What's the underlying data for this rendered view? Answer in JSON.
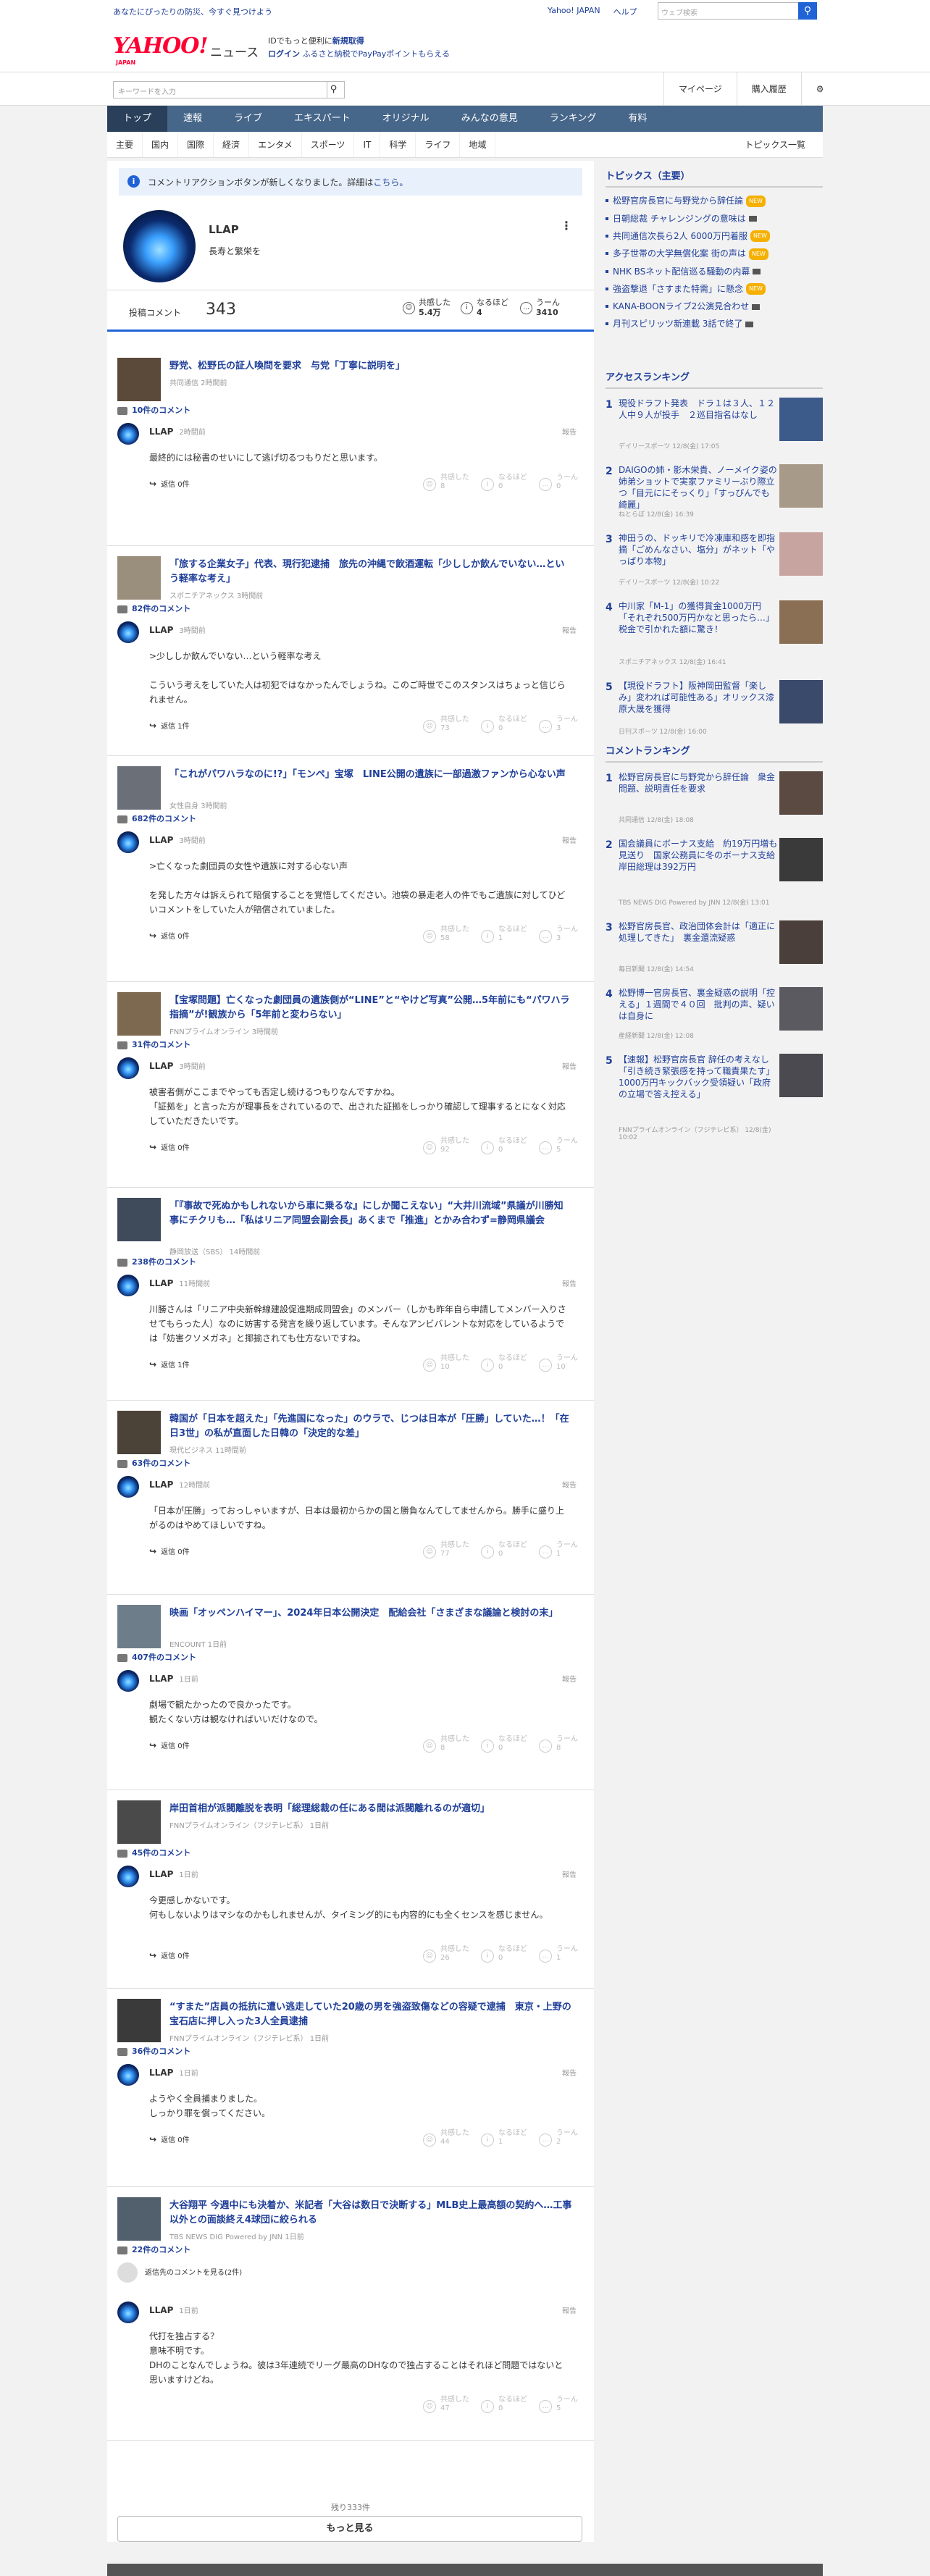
{
  "top": {
    "promo": "あなたにぴったりの防災、今すぐ見つけよう",
    "links": [
      "Yahoo! JAPAN",
      "ヘルプ"
    ],
    "search_placeholder": "ウェブ検索"
  },
  "header": {
    "logo": "YAHOO!",
    "logo_sub": "JAPAN",
    "service": "ニュース",
    "id_line1": "IDでもっと便利に",
    "id_new": "新規取得",
    "login": "ログイン",
    "id_line2": "ふるさと納税でPayPayポイントもらえる"
  },
  "search": {
    "placeholder": "キーワードを入力",
    "mypage": "マイページ",
    "history": "購入履歴"
  },
  "nav": [
    "トップ",
    "速報",
    "ライブ",
    "エキスパート",
    "オリジナル",
    "みんなの意見",
    "ランキング",
    "有料"
  ],
  "subnav": [
    "主要",
    "国内",
    "国際",
    "経済",
    "エンタメ",
    "スポーツ",
    "IT",
    "科学",
    "ライフ",
    "地域"
  ],
  "subnav_all": "トピックス一覧",
  "notice": {
    "text": "コメントリアクションボタンが新しくなりました。詳細は",
    "link": "こちら。"
  },
  "profile": {
    "name": "LLAP",
    "desc": "長寿と繁栄を",
    "count_label": "投稿コメント",
    "count": "343",
    "stats": [
      {
        "label": "共感した",
        "value": "5.4万"
      },
      {
        "label": "なるほど",
        "value": "4"
      },
      {
        "label": "うーん",
        "value": "3410"
      }
    ]
  },
  "posts": [
    {
      "title": "野党、松野氏の証人喚問を要求　与党「丁寧に説明を」",
      "source": "共同通信 2時間前",
      "comments": "10件のコメント",
      "user": "LLAP",
      "time": "2時間前",
      "text": "最終的には秘書のせいにして逃げ切るつもりだと思います。",
      "reply": "返信 0件",
      "r": [
        "8",
        "0",
        "0"
      ]
    },
    {
      "title": "「旅する企業女子」代表、現行犯逮捕　旅先の沖縄で飲酒運転「少ししか飲んでいない…という軽率な考え」",
      "source": "スポニチアネックス 3時間前",
      "comments": "82件のコメント",
      "user": "LLAP",
      "time": "3時間前",
      "text": ">少ししか飲んでいない…という軽率な考え\n\nこういう考えをしていた人は初犯ではなかったんでしょうね。このご時世でこのスタンスはちょっと信じられません。",
      "reply": "返信 1件",
      "r": [
        "73",
        "0",
        "3"
      ]
    },
    {
      "title": "「これがパワハラなのに!?」「モンペ」宝塚　LINE公開の遺族に一部過激ファンから心ない声",
      "source": "女性自身 3時間前",
      "comments": "682件のコメント",
      "user": "LLAP",
      "time": "3時間前",
      "text": ">亡くなった劇団員の女性や遺族に対する心ない声\n\nを発した方々は訴えられて賠償することを覚悟してください。池袋の暴走老人の件でもご遺族に対してひどいコメントをしていた人が賠償されていました。",
      "reply": "返信 0件",
      "r": [
        "58",
        "1",
        "3"
      ]
    },
    {
      "title": "【宝塚問題】亡くなった劇団員の遺族側が“LINE”と“やけど写真”公開…5年前にも“パワハラ指摘”が!観族から「5年前と変わらない」",
      "source": "FNNプライムオンライン 3時間前",
      "comments": "31件のコメント",
      "user": "LLAP",
      "time": "3時間前",
      "text": "被害者側がここまでやっても否定し続けるつもりなんですかね。\n「証拠を」と言った方が理事長をされているので、出された証拠をしっかり確認して理事するとになく対応していただきたいです。",
      "reply": "返信 0件",
      "r": [
        "92",
        "0",
        "5"
      ]
    },
    {
      "title": "「『事故で死ぬかもしれないから車に乗るな』にしか聞こえない」“大井川流域”県議が川勝知事にチクリも…「私はリニア同盟会副会長」あくまで「推進」とかみ合わず=静岡県議会",
      "source": "静岡放送（SBS） 14時間前",
      "comments": "238件のコメント",
      "user": "LLAP",
      "time": "11時間前",
      "text": "川勝さんは「リニア中央新幹線建設促進期成同盟会」のメンバー（しかも昨年自ら申請してメンバー入りさせてもらった人）なのに妨害する発言を繰り返しています。そんなアンビバレントな対応をしているようでは「妨害クソメガネ」と揶揄されても仕方ないですね。",
      "reply": "返信 1件",
      "r": [
        "10",
        "0",
        "10"
      ]
    },
    {
      "title": "韓国が「日本を超えた」「先進国になった」のウラで、じつは日本が「圧勝」していた…！「在日3世」の私が直面した日韓の「決定的な差」",
      "source": "現代ビジネス 11時間前",
      "comments": "63件のコメント",
      "user": "LLAP",
      "time": "12時間前",
      "text": "「日本が圧勝」っておっしゃいますが、日本は最初からかの国と勝負なんてしてませんから。勝手に盛り上がるのはやめてほしいですね。",
      "reply": "返信 0件",
      "r": [
        "77",
        "0",
        "1"
      ]
    },
    {
      "title": "映画「オッペンハイマー」、2024年日本公開決定　配給会社「さまざまな議論と検討の末」",
      "source": "ENCOUNT 1日前",
      "comments": "407件のコメント",
      "user": "LLAP",
      "time": "1日前",
      "text": "劇場で観たかったので良かったです。\n観たくない方は観なければいいだけなので。",
      "reply": "返信 0件",
      "r": [
        "8",
        "0",
        "8"
      ]
    },
    {
      "title": "岸田首相が派閥離脱を表明「総理総裁の任にある間は派閥離れるのが適切」",
      "source": "FNNプライムオンライン（フジテレビ系） 1日前",
      "comments": "45件のコメント",
      "user": "LLAP",
      "time": "1日前",
      "text": "今更感しかないです。\n何もしないよりはマシなのかもしれませんが、タイミング的にも内容的にも全くセンスを感じません。",
      "reply": "返信 0件",
      "r": [
        "26",
        "0",
        "1"
      ]
    },
    {
      "title": "“すまた”店員の抵抗に遭い逃走していた20歳の男を強盗致傷などの容疑で逮捕　東京・上野の宝石店に押し入った3人全員逮捕",
      "source": "FNNプライムオンライン（フジテレビ系） 1日前",
      "comments": "36件のコメント",
      "user": "LLAP",
      "time": "1日前",
      "text": "ようやく全員捕まりました。\nしっかり罪を償ってください。",
      "reply": "返信 0件",
      "r": [
        "44",
        "1",
        "2"
      ]
    },
    {
      "title": "大谷翔平 今週中にも決着か、米記者「大谷は数日で決断する」MLB史上最高額の契約へ…工事以外との面談終え4球団に絞られる",
      "source": "TBS NEWS DIG Powered by JNN 1日前",
      "comments": "22件のコメント",
      "reply_to": "返信先のコメントを見る(2件)",
      "user": "LLAP",
      "time": "1日前",
      "text": "代打を独占する？\n意味不明です。\nDHのことなんでしょうね。彼は3年連続でリーグ最高のDHなので独占することはそれほど問題ではないと思いますけどね。",
      "reply": "",
      "r": [
        "47",
        "0",
        "5"
      ]
    }
  ],
  "reactions": [
    "共感した",
    "なるほど",
    "うーん"
  ],
  "report": "報告",
  "remain": "残り333件",
  "more": "もっと見る",
  "sidebar": {
    "topics_title": "トピックス（主要）",
    "topics": [
      {
        "t": "松野官房長官に与野党から辞任論",
        "b": "NEW"
      },
      {
        "t": "日朝総裁 チャレンジングの意味は",
        "b": ""
      },
      {
        "t": "共同通信次長ら2人 6000万円着服",
        "b": "NEW"
      },
      {
        "t": "多子世帯の大学無償化案 街の声は",
        "b": "NEW"
      },
      {
        "t": "NHK BSネット配信巡る騒動の内幕",
        "b": ""
      },
      {
        "t": "強盗撃退「さすまた特需」に懸念",
        "b": "NEW"
      },
      {
        "t": "KANA-BOONライブ2公演見合わせ",
        "b": ""
      },
      {
        "t": "月刊スピリッツ新連載 3話で終了",
        "b": ""
      }
    ],
    "access_title": "アクセスランキング",
    "access": [
      {
        "t": "現役ドラフト発表　ドラ１は３人、１２人中９人が投手　２巡目指名はなし",
        "s": "デイリースポーツ 12/8(金) 17:05"
      },
      {
        "t": "DAIGOの姉・影木栄貴、ノーメイク姿の姉弟ショットで実家ファミリーぶり際立つ「目元ににそっくり」「すっぴんでも綺麗」",
        "s": "ねとらぼ 12/8(金) 16:39"
      },
      {
        "t": "神田うの、ドッキリで冷凍庫和感を即指摘「ごめんなさい、塩分」がネット「やっぱり本物」",
        "s": "デイリースポーツ 12/8(金) 10:22"
      },
      {
        "t": "中川家「M-1」の獲得賞金1000万円「それぞれ500万円かなと思ったら…」税金で引かれた額に驚き！",
        "s": "スポニチアネックス 12/8(金) 16:41"
      },
      {
        "t": "【現役ドラフト】阪神岡田監督「楽しみ」変われば可能性ある」オリックス漆原大晟を獲得",
        "s": "日刊スポーツ 12/8(金) 16:00"
      }
    ],
    "comment_title": "コメントランキング",
    "comment": [
      {
        "t": "松野官房長官に与野党から辞任論　衆金問題、説明責任を要求",
        "s": "共同通信 12/8(金) 18:08"
      },
      {
        "t": "国会議員にボーナス支給　約19万円増も見送り　国家公務員に冬のボーナス支給　岸田総理は392万円",
        "s": "TBS NEWS DIG Powered by JNN 12/8(金) 13:01"
      },
      {
        "t": "松野官房長官、政治団体会計は「適正に処理してきた」　裏金還流疑惑",
        "s": "毎日新聞 12/8(金) 14:54"
      },
      {
        "t": "松野博一官房長官、裏金疑惑の説明「控える」１週間で４０回　批判の声、疑いは自身に",
        "s": "産経新聞 12/8(金) 12:08"
      },
      {
        "t": "【速報】松野官房長官 辞任の考えなし「引き続き緊張感を持って職責果たす」　1000万円キックバック受領疑い「政府の立場で答え控える」",
        "s": "FNNプライムオンライン（フジテレビ系） 12/8(金) 10:02"
      }
    ]
  }
}
